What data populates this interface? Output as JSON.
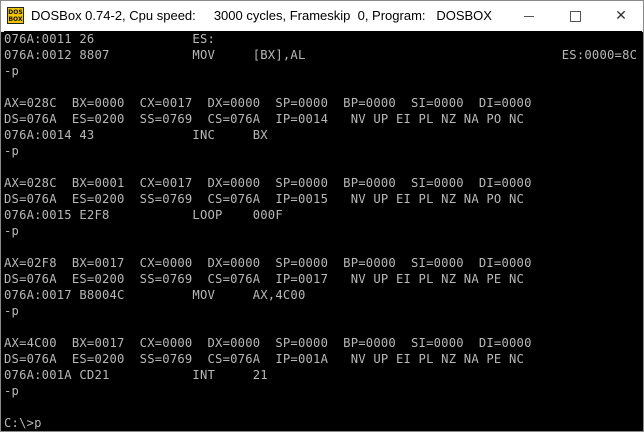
{
  "window": {
    "title": "DOSBox 0.74-2, Cpu speed:     3000 cycles, Frameskip  0, Program:   DOSBOX",
    "icon_label": "DOS BOX",
    "icon": "dosbox-icon",
    "controls": {
      "minimize": "minimize-icon",
      "maximize": "maximize-icon",
      "close_glyph": "✕"
    }
  },
  "terminal": {
    "lines": [
      "076A:0011 26             ES:",
      "076A:0012 8807           MOV     [BX],AL                                  ES:0000=8C",
      "-p",
      "",
      "AX=028C  BX=0000  CX=0017  DX=0000  SP=0000  BP=0000  SI=0000  DI=0000",
      "DS=076A  ES=0200  SS=0769  CS=076A  IP=0014   NV UP EI PL NZ NA PO NC",
      "076A:0014 43             INC     BX",
      "-p",
      "",
      "AX=028C  BX=0001  CX=0017  DX=0000  SP=0000  BP=0000  SI=0000  DI=0000",
      "DS=076A  ES=0200  SS=0769  CS=076A  IP=0015   NV UP EI PL NZ NA PO NC",
      "076A:0015 E2F8           LOOP    000F",
      "-p",
      "",
      "AX=02F8  BX=0017  CX=0000  DX=0000  SP=0000  BP=0000  SI=0000  DI=0000",
      "DS=076A  ES=0200  SS=0769  CS=076A  IP=0017   NV UP EI PL NZ NA PE NC",
      "076A:0017 B8004C         MOV     AX,4C00",
      "-p",
      "",
      "AX=4C00  BX=0017  CX=0000  DX=0000  SP=0000  BP=0000  SI=0000  DI=0000",
      "DS=076A  ES=0200  SS=0769  CS=076A  IP=001A   NV UP EI PL NZ NA PE NC",
      "076A:001A CD21           INT     21",
      "-p",
      "",
      "C:\\>p"
    ]
  },
  "colors": {
    "terminal_bg": "#000000",
    "terminal_fg": "#b8b8b8",
    "titlebar_bg": "#ffffff"
  }
}
